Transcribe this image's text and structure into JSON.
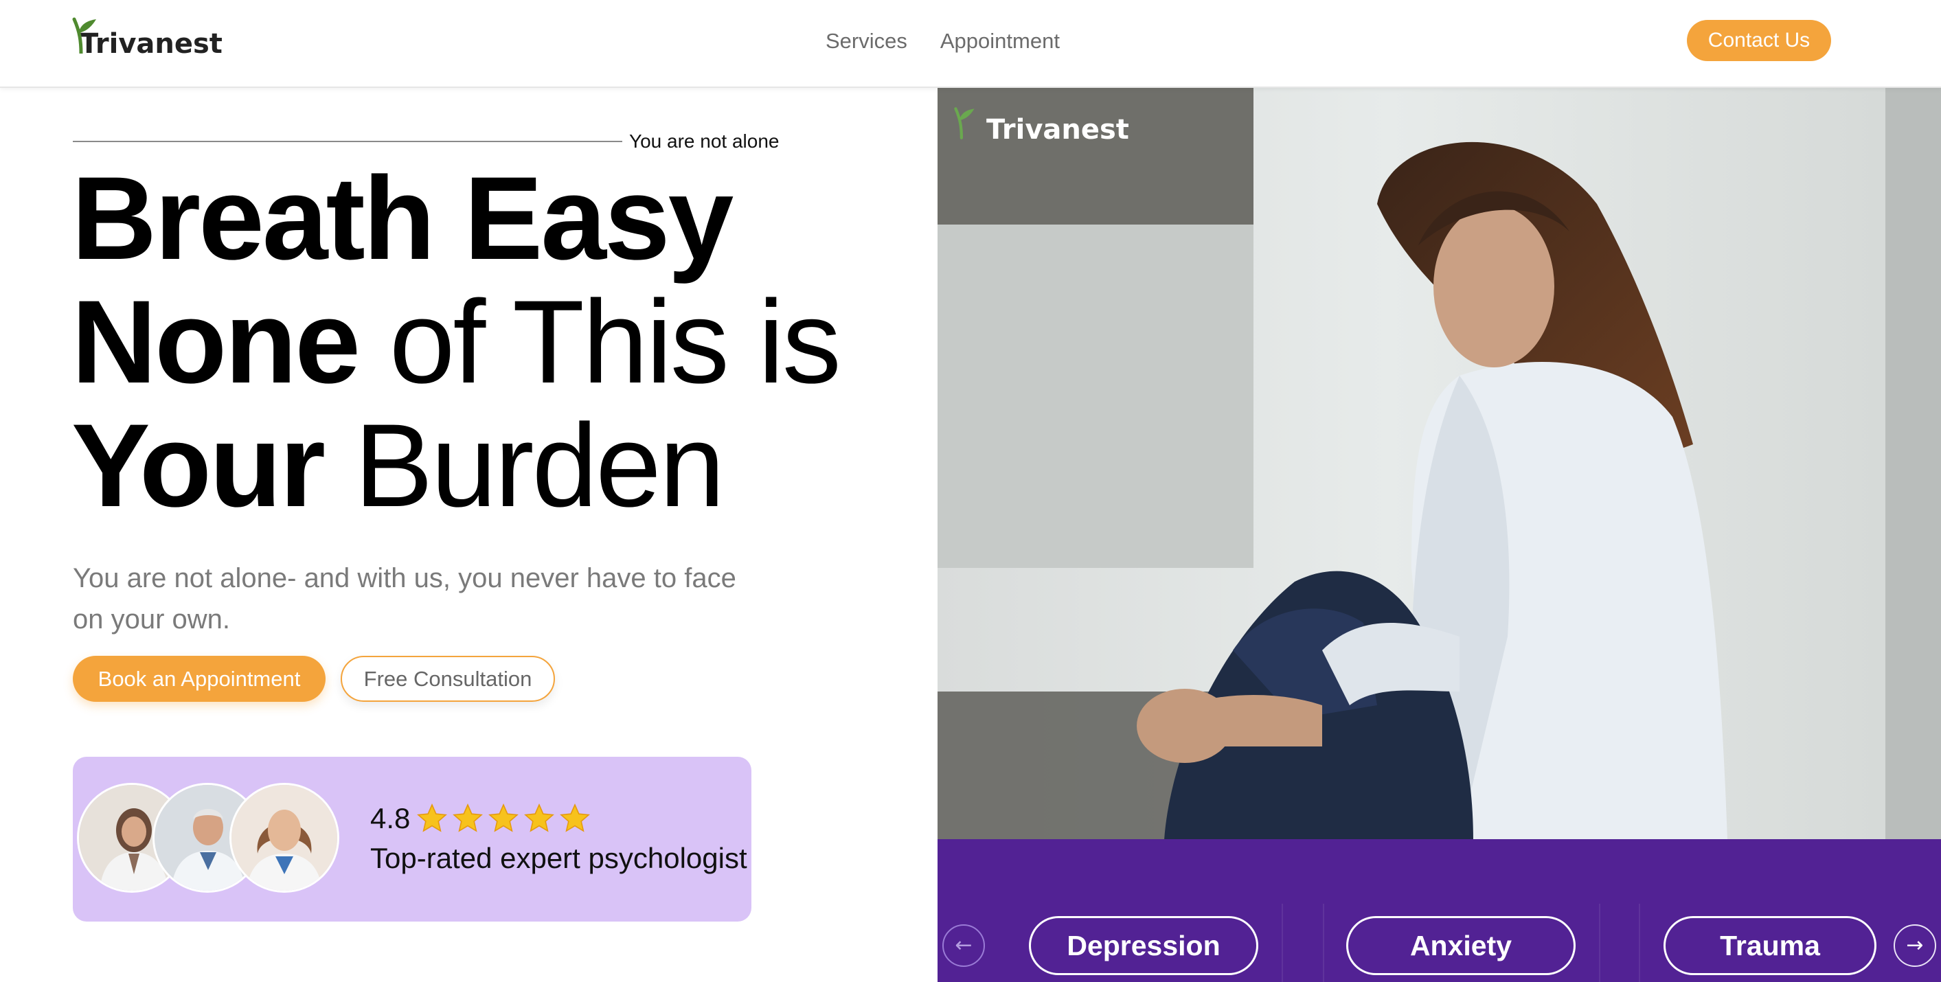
{
  "header": {
    "logo_text": "Trivanest",
    "nav": [
      {
        "label": "Services"
      },
      {
        "label": "Appointment"
      }
    ],
    "contact_label": "Contact Us"
  },
  "hero": {
    "tagline": "You are not alone",
    "headline": {
      "line1_bold": "Breath Easy",
      "line2_bold": "None",
      "line2_regular": "of This is",
      "line3_bold": "Your",
      "line3_regular": "Burden"
    },
    "subtext": "You are not alone- and with us, you never have to face on your own.",
    "primary_button": "Book an Appointment",
    "secondary_button": "Free Consultation",
    "rating": {
      "value": "4.8",
      "stars": 5,
      "label": "Top-rated expert psychologist"
    }
  },
  "image_panel": {
    "logo_text": "Trivanest",
    "carousel": {
      "prev_icon": "arrow-left-icon",
      "next_icon": "arrow-right-icon",
      "items": [
        {
          "label": "Depression"
        },
        {
          "label": "Anxiety"
        },
        {
          "label": "Trauma"
        }
      ]
    }
  },
  "colors": {
    "accent_orange": "#f4a43c",
    "rating_card_bg": "#d9c3f7",
    "carousel_bg": "#522294",
    "logo_leaf": "#4f8a2f"
  }
}
